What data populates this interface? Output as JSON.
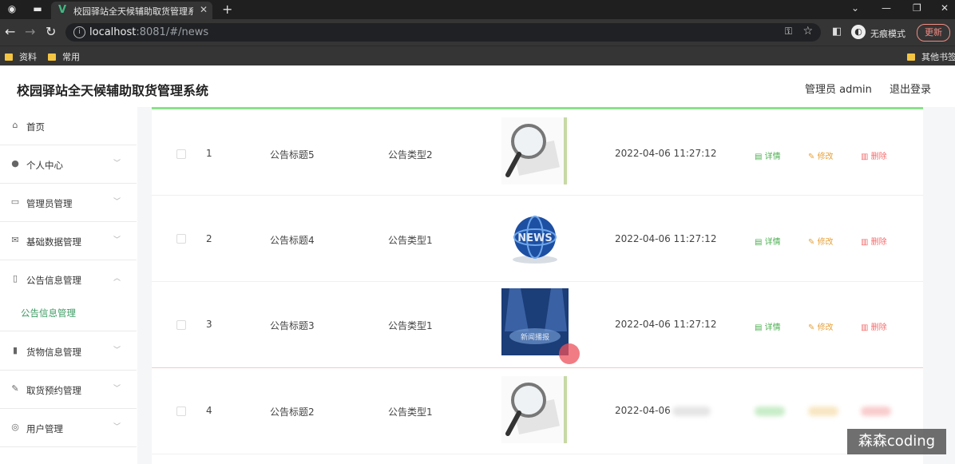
{
  "browser": {
    "tab_title": "校园驿站全天候辅助取货管理系统",
    "address_host": "localhost",
    "address_path": ":8081/#/news",
    "incognito_label": "无痕模式",
    "update_label": "更新",
    "bookmarks": [
      "资料",
      "常用"
    ],
    "other_bookmarks": "其他书签"
  },
  "header": {
    "title": "校园驿站全天候辅助取货管理系统",
    "admin": "管理员 admin",
    "logout": "退出登录"
  },
  "sidebar": {
    "items": [
      {
        "label": "首页",
        "icon": "home-icon"
      },
      {
        "label": "个人中心",
        "icon": "user-icon"
      },
      {
        "label": "管理员管理",
        "icon": "chat-icon"
      },
      {
        "label": "基础数据管理",
        "icon": "mail-icon"
      },
      {
        "label": "公告信息管理",
        "icon": "phone-icon"
      },
      {
        "label": "货物信息管理",
        "icon": "books-icon"
      },
      {
        "label": "取货预约管理",
        "icon": "edit-icon"
      },
      {
        "label": "用户管理",
        "icon": "compass-icon"
      }
    ],
    "active_sub": "公告信息管理"
  },
  "table": {
    "rows": [
      {
        "index": "1",
        "title": "公告标题5",
        "type": "公告类型2",
        "time": "2022-04-06 11:27:12"
      },
      {
        "index": "2",
        "title": "公告标题4",
        "type": "公告类型1",
        "time": "2022-04-06 11:27:12"
      },
      {
        "index": "3",
        "title": "公告标题3",
        "type": "公告类型1",
        "time": "2022-04-06 11:27:12"
      },
      {
        "index": "4",
        "title": "公告标题2",
        "type": "公告类型1",
        "time": "2022-04-06"
      }
    ],
    "actions": {
      "detail": "详情",
      "edit": "修改",
      "delete": "删除"
    }
  },
  "thumb_texts": {
    "globe": "NEWS",
    "stage": "新闻播报"
  },
  "watermark": "森森coding",
  "colors": {
    "accent": "#3c9b63",
    "detail": "#4caf50",
    "edit": "#e6a23c",
    "delete": "#f56c6c",
    "topbar": "#8be08b"
  }
}
